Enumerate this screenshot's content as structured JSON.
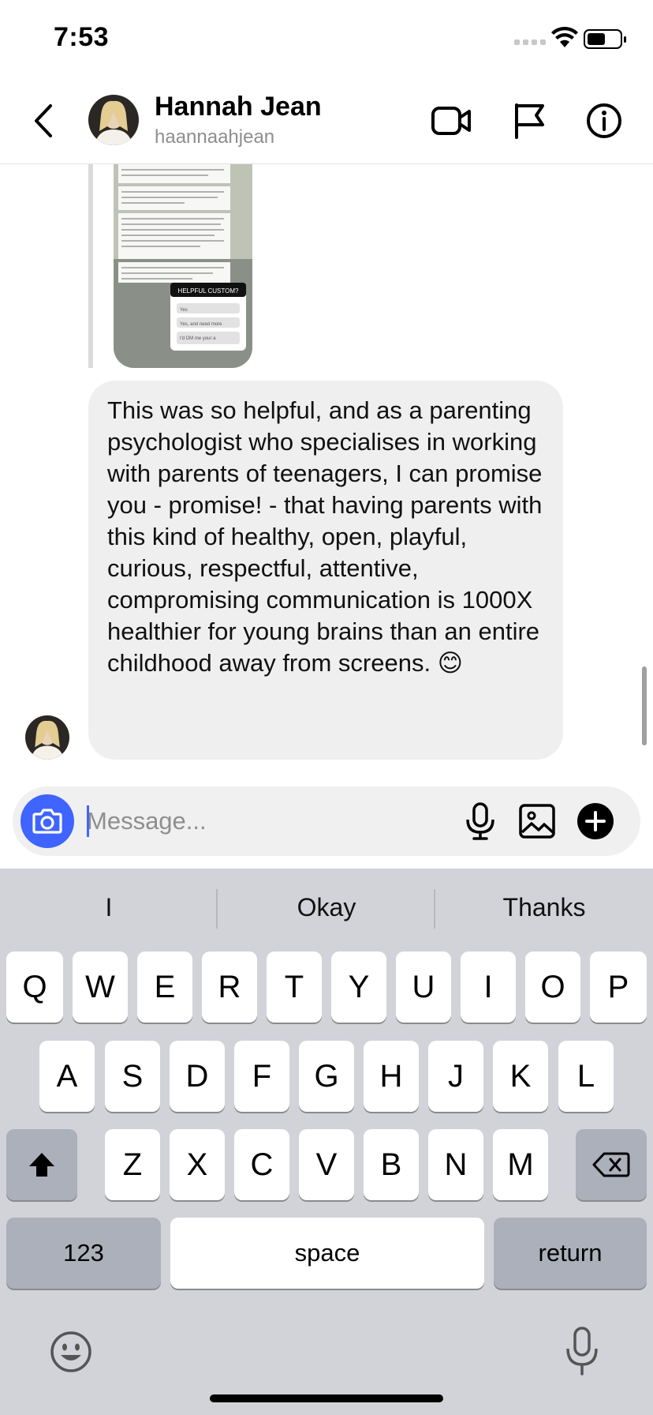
{
  "status_bar": {
    "time": "7:53"
  },
  "header": {
    "name": "Hannah Jean",
    "username": "haannaahjean"
  },
  "shared_post": {
    "overlay_title": "HELPFUL CUSTOM?",
    "options": [
      "Yes",
      "Yes, and need more",
      "I'd DM me your a",
      ""
    ]
  },
  "message": {
    "text": "This was so helpful, and as a parenting psychologist who specialises in working with parents of teenagers, I can promise you - promise! - that having parents with this kind of healthy, open, playful, curious, respectful, attentive, compromising communication is 1000X healthier for young brains than an entire childhood away from screens. 😊"
  },
  "composer": {
    "placeholder": "Message..."
  },
  "keyboard": {
    "suggestions": [
      "I",
      "Okay",
      "Thanks"
    ],
    "row1": [
      "Q",
      "W",
      "E",
      "R",
      "T",
      "Y",
      "U",
      "I",
      "O",
      "P"
    ],
    "row2": [
      "A",
      "S",
      "D",
      "F",
      "G",
      "H",
      "J",
      "K",
      "L"
    ],
    "row3": [
      "Z",
      "X",
      "C",
      "V",
      "B",
      "N",
      "M"
    ],
    "numbers_label": "123",
    "space_label": "space",
    "return_label": "return"
  },
  "colors": {
    "accent": "#3f64ff",
    "bubble": "#efefef",
    "keyboard_bg": "#d1d3d9"
  }
}
